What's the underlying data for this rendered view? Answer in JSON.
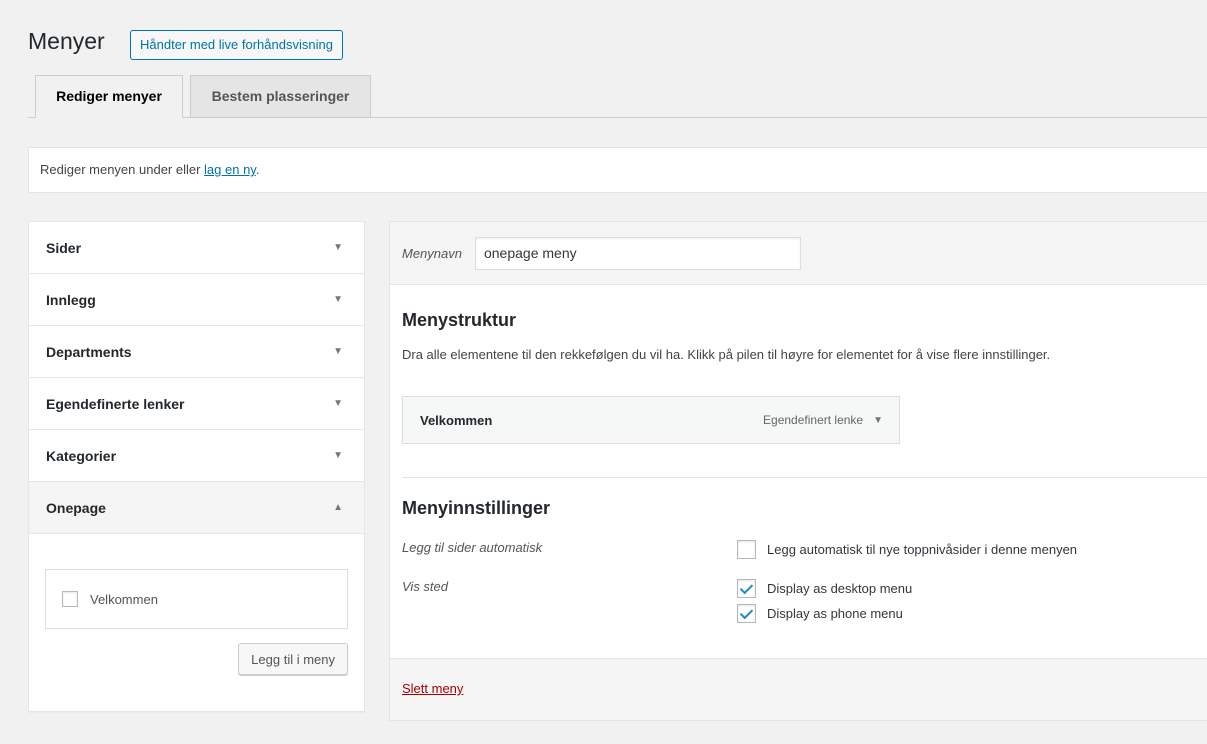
{
  "header": {
    "title": "Menyer",
    "live_button": "Håndter med live forhåndsvisning"
  },
  "tabs": [
    {
      "label": "Rediger menyer",
      "active": true
    },
    {
      "label": "Bestem plasseringer",
      "active": false
    }
  ],
  "notice": {
    "text": "Rediger menyen under eller ",
    "link": "lag en ny",
    "suffix": "."
  },
  "accordion": {
    "items": [
      {
        "label": "Sider",
        "open": false
      },
      {
        "label": "Innlegg",
        "open": false
      },
      {
        "label": "Departments",
        "open": false
      },
      {
        "label": "Egendefinerte lenker",
        "open": false
      },
      {
        "label": "Kategorier",
        "open": false
      },
      {
        "label": "Onepage",
        "open": true
      }
    ],
    "arrow_closed": "▼",
    "arrow_open": "▲",
    "onepage": {
      "option": {
        "label": "Velkommen",
        "checked": false
      },
      "add_button": "Legg til i meny"
    }
  },
  "menu_editor": {
    "name_label": "Menynavn",
    "name_value": "onepage meny",
    "structure_title": "Menystruktur",
    "structure_desc": "Dra alle elementene til den rekkefølgen du vil ha. Klikk på pilen til høyre for elementet for å vise flere innstillinger.",
    "items": [
      {
        "title": "Velkommen",
        "type": "Egendefinert lenke",
        "arrow": "▼"
      }
    ],
    "settings_title": "Menyinnstillinger",
    "auto_add_label": "Legg til sider automatisk",
    "auto_add_option": {
      "label": "Legg automatisk til nye toppnivåsider i denne menyen",
      "checked": false
    },
    "location_label": "Vis sted",
    "locations": [
      {
        "label": "Display as desktop menu",
        "checked": true
      },
      {
        "label": "Display as phone menu",
        "checked": true
      }
    ],
    "delete_link": "Slett meny"
  },
  "colors": {
    "accent": "#0073aa",
    "danger": "#a00",
    "check": "#1e8cbe",
    "background": "#f1f1f1"
  }
}
